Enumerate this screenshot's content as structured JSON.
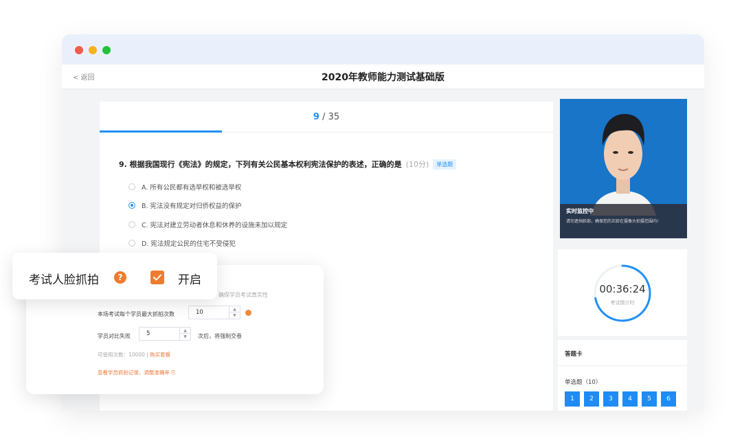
{
  "window": {
    "back_label": "< 返回",
    "title": "2020年教师能力测试基础版"
  },
  "progress": {
    "current": "9",
    "separator": " / ",
    "total": "35",
    "fraction": 0.27
  },
  "question": {
    "text": "9. 根据我国现行《宪法》的规定，下列有关公民基本权利宪法保护的表述，正确的是",
    "score": "(10分)",
    "tag": "单选题",
    "options": [
      {
        "label": "A. 所有公民都有选举权和被选举权",
        "selected": false
      },
      {
        "label": "B. 宪法没有规定对归侨权益的保护",
        "selected": true
      },
      {
        "label": "C. 宪法对建立劳动者休息和休养的设施未加以规定",
        "selected": false
      },
      {
        "label": "D. 宪法规定公民的住宅不受侵犯",
        "selected": false
      }
    ]
  },
  "camera": {
    "title": "实时监控中",
    "desc": "请勿遮挡脸部，确保您的正脸在摄像头拍摄范围内!"
  },
  "timer": {
    "value": "00:36:24",
    "label": "考试倒计时",
    "remaining_fraction": 0.72
  },
  "answer_card": {
    "title": "答题卡",
    "section": "单选题（10）",
    "numbers": [
      "1",
      "2",
      "3",
      "4",
      "5",
      "6"
    ]
  },
  "face_capture": {
    "label": "考试人脸抓拍",
    "help_icon": "?",
    "toggle_label": "开启",
    "enabled": true,
    "hint_tail": "确保学员考试真实性",
    "max_label": "本场考试每个学员最大抓拍次数",
    "max_value": "10",
    "fail_label": "学员对比失败",
    "fail_value": "5",
    "fail_suffix": "次后，将强制交卷",
    "available_prefix": "可使用次数：10000 |",
    "buy_link": "购买套餐",
    "check_link": "查看学员抓拍记录、调整准确率 ⎘"
  },
  "colors": {
    "primary": "#2190f6",
    "orange": "#ef7b2e"
  }
}
